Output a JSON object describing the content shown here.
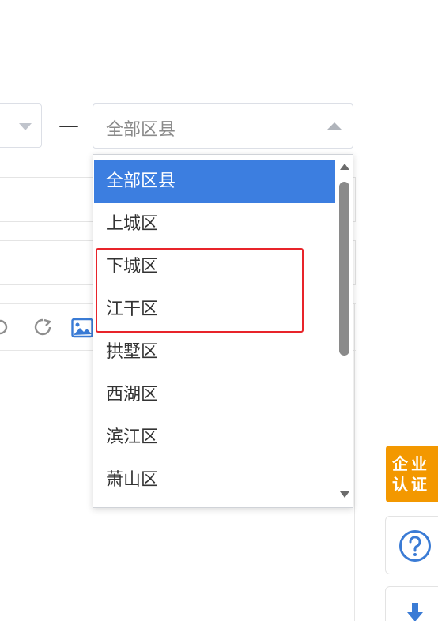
{
  "form": {
    "range_separator": "—",
    "district_select": {
      "value": "全部区县"
    }
  },
  "dropdown": {
    "options": [
      {
        "label": "全部区县",
        "selected": true
      },
      {
        "label": "上城区",
        "selected": false
      },
      {
        "label": "下城区",
        "selected": false
      },
      {
        "label": "江干区",
        "selected": false
      },
      {
        "label": "拱墅区",
        "selected": false
      },
      {
        "label": "西湖区",
        "selected": false
      },
      {
        "label": "滨江区",
        "selected": false
      },
      {
        "label": "萧山区",
        "selected": false
      }
    ],
    "highlighted_options": [
      "下城区",
      "江干区"
    ]
  },
  "toolbar": {
    "icons": [
      "undo-icon",
      "redo-icon",
      "image-icon"
    ]
  },
  "side_buttons": {
    "cert_line1": "企业",
    "cert_line2": "认证",
    "help_icon": "question-circle-icon",
    "download_icon": "download-arrow-icon"
  },
  "colors": {
    "selected_bg": "#3c7ee0",
    "highlight_border": "#e8242a",
    "cert_bg": "#f39800",
    "icon_blue": "#3a7bd5"
  }
}
